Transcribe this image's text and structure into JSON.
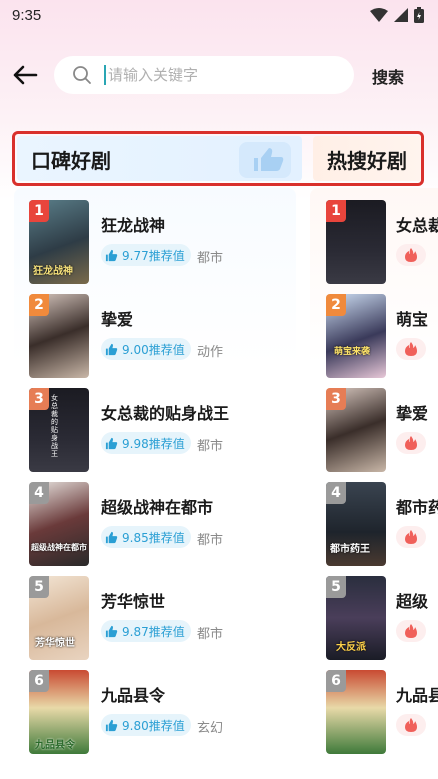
{
  "status": {
    "time": "9:35"
  },
  "search": {
    "placeholder": "请输入关键字",
    "value": "",
    "button_label": "搜索"
  },
  "tabs": [
    {
      "label": "口碑好剧",
      "active": true
    },
    {
      "label": "热搜好剧",
      "active": false
    }
  ],
  "rank_colors": [
    "#e8453c",
    "#f08a3c",
    "#e67d55",
    "#9a9a9a",
    "#9a9a9a",
    "#9a9a9a"
  ],
  "koubei": [
    {
      "rank": "1",
      "title": "狂龙战神",
      "score": "9.77推荐值",
      "genre": "都市"
    },
    {
      "rank": "2",
      "title": "挚爱",
      "score": "9.00推荐值",
      "genre": "动作"
    },
    {
      "rank": "3",
      "title": "女总裁的贴身战王",
      "score": "9.98推荐值",
      "genre": "都市"
    },
    {
      "rank": "4",
      "title": "超级战神在都市",
      "score": "9.85推荐值",
      "genre": "都市"
    },
    {
      "rank": "5",
      "title": "芳华惊世",
      "score": "9.87推荐值",
      "genre": "都市"
    },
    {
      "rank": "6",
      "title": "九品县令",
      "score": "9.80推荐值",
      "genre": "玄幻"
    }
  ],
  "resou": [
    {
      "rank": "1",
      "title": "女总裁的贴身战王"
    },
    {
      "rank": "2",
      "title": "萌宝"
    },
    {
      "rank": "3",
      "title": "挚爱"
    },
    {
      "rank": "4",
      "title": "都市药王"
    },
    {
      "rank": "5",
      "title": "超级"
    },
    {
      "rank": "6",
      "title": "九品县令"
    }
  ],
  "poster_texts": {
    "p1": "狂龙战神",
    "p3": "女总裁的贴身战王",
    "p4": "超级战神在都市",
    "p5": "芳华惊世",
    "p6": "九品县令",
    "r2": "萌宝来袭",
    "r4": "都市药王",
    "r5": "大反派"
  }
}
